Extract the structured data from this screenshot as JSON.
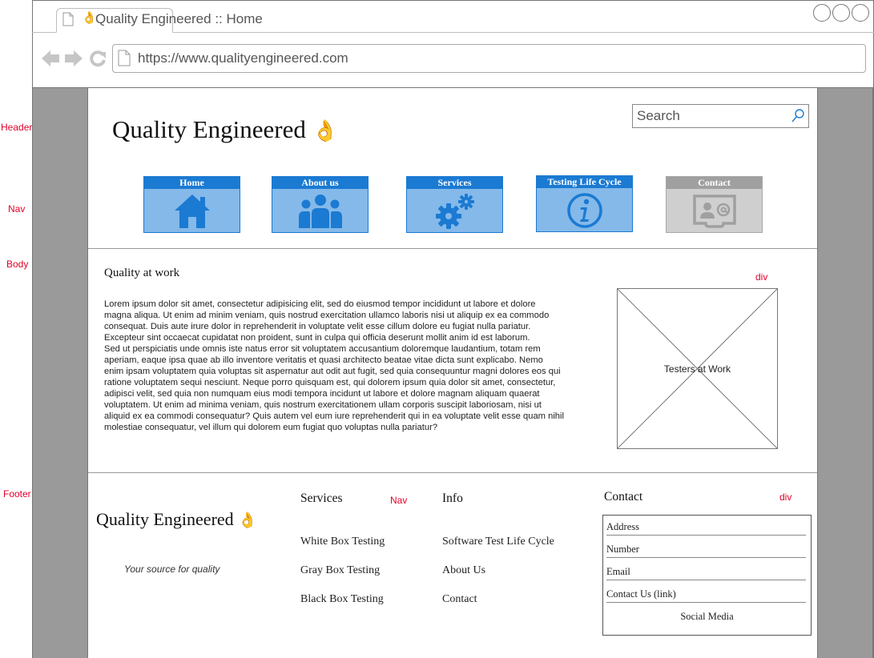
{
  "browser": {
    "tab_title": "Quality Engineered :: Home",
    "url": "https://www.qualityengineered.com"
  },
  "annotations": {
    "header": "Header",
    "nav": "Nav",
    "body": "Body",
    "footer": "Footer",
    "body_div": "div",
    "footer_nav": "Nav",
    "footer_div": "div"
  },
  "header": {
    "title": "Quality Engineered",
    "title_emoji": "👌",
    "search_placeholder": "Search"
  },
  "nav": {
    "items": [
      {
        "label": "Home",
        "icon": "home-icon"
      },
      {
        "label": "About us",
        "icon": "users-icon"
      },
      {
        "label": "Services",
        "icon": "gears-icon"
      },
      {
        "label": "Testing Life Cycle",
        "icon": "info-icon"
      },
      {
        "label": "Contact",
        "icon": "contact-card-icon"
      }
    ]
  },
  "main": {
    "heading": "Quality at work",
    "paragraphs": [
      "Lorem ipsum dolor sit amet, consectetur adipisicing elit, sed do eiusmod tempor incididunt ut labore et dolore magna aliqua. Ut enim ad minim veniam, quis nostrud exercitation ullamco laboris nisi ut aliquip ex ea commodo consequat. Duis aute irure dolor in reprehenderit in voluptate velit esse cillum dolore eu fugiat nulla pariatur. Excepteur sint occaecat cupidatat non proident, sunt in culpa qui officia deserunt mollit anim id est laborum.",
      "Sed ut perspiciatis unde omnis iste natus error sit voluptatem accusantium doloremque laudantium, totam rem aperiam, eaque ipsa quae ab illo inventore veritatis et quasi architecto beatae vitae dicta sunt explicabo. Nemo enim ipsam voluptatem quia voluptas sit aspernatur aut odit aut fugit, sed quia consequuntur magni dolores eos qui ratione voluptatem sequi nesciunt. Neque porro quisquam est, qui dolorem ipsum quia dolor sit amet, consectetur, adipisci velit, sed quia non numquam eius modi tempora incidunt ut labore et dolore magnam aliquam quaerat voluptatem. Ut enim ad minima veniam, quis nostrum exercitationem ullam corporis suscipit laboriosam, nisi ut aliquid ex ea commodi consequatur? Quis autem vel eum iure reprehenderit qui in ea voluptate velit esse quam nihil molestiae consequatur, vel illum qui dolorem eum fugiat quo voluptas nulla pariatur?"
    ],
    "image_caption": "Testers at Work"
  },
  "footer": {
    "title": "Quality Engineered",
    "title_emoji": "👌",
    "tagline": "Your source for quality",
    "services": {
      "heading": "Services",
      "links": [
        "White Box Testing",
        "Gray Box Testing",
        "Black Box Testing"
      ]
    },
    "info": {
      "heading": "Info",
      "links": [
        "Software Test Life Cycle",
        "About Us",
        "Contact"
      ]
    },
    "contact": {
      "heading": "Contact",
      "rows": [
        "Address",
        "Number",
        "Email",
        "Contact Us (link)"
      ],
      "social": "Social Media"
    }
  },
  "colors": {
    "nav_blue": "#1b7ad2",
    "nav_fill": "#84b9e9",
    "nav_disabled": "#a0a0a0",
    "annotation_red": "#e0002a",
    "gutter_gray": "#9a9a9a"
  }
}
